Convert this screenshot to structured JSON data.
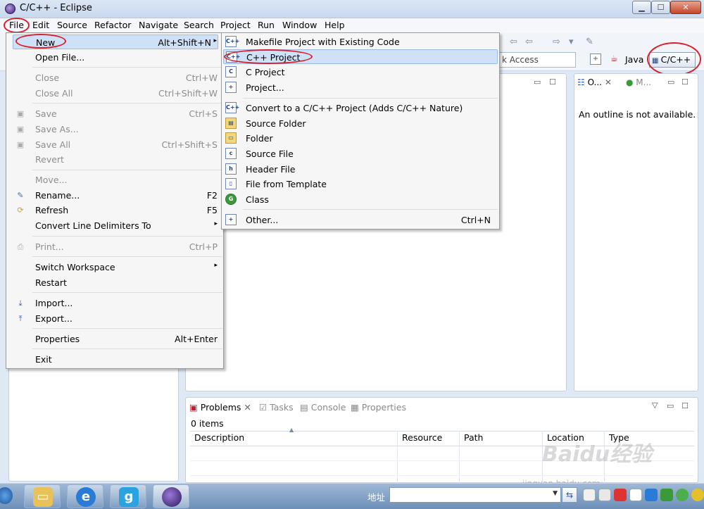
{
  "window": {
    "title": "C/C++ - Eclipse",
    "min_glyph": "▁",
    "max_glyph": "☐",
    "close_glyph": "✕"
  },
  "menubar": [
    "File",
    "Edit",
    "Source",
    "Refactor",
    "Navigate",
    "Search",
    "Project",
    "Run",
    "Window",
    "Help"
  ],
  "toolbar": {
    "quick_access": "k Access"
  },
  "perspectives": {
    "java": "Java",
    "cpp": "C/C++"
  },
  "file_menu": [
    {
      "label": "New",
      "accel": "Alt+Shift+N",
      "arrow": "▸",
      "highlighted": true
    },
    {
      "label": "Open File...",
      "accel": ""
    },
    {
      "label": "Close",
      "accel": "Ctrl+W",
      "disabled": true
    },
    {
      "label": "Close All",
      "accel": "Ctrl+Shift+W",
      "disabled": true
    },
    {
      "label": "Save",
      "accel": "Ctrl+S",
      "disabled": true
    },
    {
      "label": "Save As...",
      "accel": "",
      "disabled": true
    },
    {
      "label": "Save All",
      "accel": "Ctrl+Shift+S",
      "disabled": true
    },
    {
      "label": "Revert",
      "accel": "",
      "disabled": true
    },
    {
      "label": "Move...",
      "accel": "",
      "disabled": true
    },
    {
      "label": "Rename...",
      "accel": "F2"
    },
    {
      "label": "Refresh",
      "accel": "F5"
    },
    {
      "label": "Convert Line Delimiters To",
      "accel": "▸"
    },
    {
      "label": "Print...",
      "accel": "Ctrl+P",
      "disabled": true
    },
    {
      "label": "Switch Workspace",
      "accel": "▸"
    },
    {
      "label": "Restart",
      "accel": ""
    },
    {
      "label": "Import...",
      "accel": ""
    },
    {
      "label": "Export...",
      "accel": ""
    },
    {
      "label": "Properties",
      "accel": "Alt+Enter"
    },
    {
      "label": "Exit",
      "accel": ""
    }
  ],
  "new_menu": [
    {
      "label": "Makefile Project with Existing Code",
      "accel": "",
      "icon": "C++"
    },
    {
      "label": "C++ Project",
      "accel": "",
      "icon": "C++",
      "highlighted": true
    },
    {
      "label": "C Project",
      "accel": "",
      "icon": "C"
    },
    {
      "label": "Project...",
      "accel": "",
      "icon": "+"
    },
    {
      "label": "Convert to a C/C++ Project (Adds C/C++ Nature)",
      "accel": "",
      "icon": "C++"
    },
    {
      "label": "Source Folder",
      "accel": "",
      "icon": "▤"
    },
    {
      "label": "Folder",
      "accel": "",
      "icon": "▭"
    },
    {
      "label": "Source File",
      "accel": "",
      "icon": "c"
    },
    {
      "label": "Header File",
      "accel": "",
      "icon": "h"
    },
    {
      "label": "File from Template",
      "accel": "",
      "icon": "▯"
    },
    {
      "label": "Class",
      "accel": "",
      "icon": "G"
    },
    {
      "label": "Other...",
      "accel": "Ctrl+N",
      "icon": "+"
    }
  ],
  "outline": {
    "tab1": "O...",
    "tab2": "M...",
    "message": "An outline is not available."
  },
  "bottom": {
    "tabs": [
      "Problems",
      "Tasks",
      "Console",
      "Properties"
    ],
    "items": "0 items",
    "columns": [
      "Description",
      "Resource",
      "Path",
      "Location",
      "Type"
    ]
  },
  "taskbar": {
    "address_label": "地址"
  },
  "watermark": {
    "text": "Baidu经验",
    "url": "jingyan.baidu.com"
  }
}
